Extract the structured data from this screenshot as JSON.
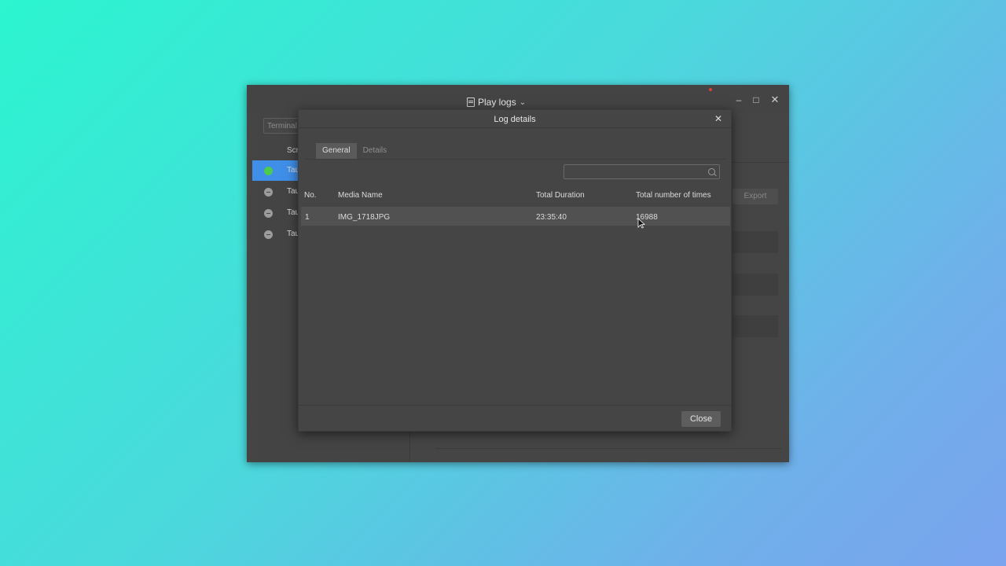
{
  "app": {
    "title": "Play logs",
    "controls": {
      "minimize": "–",
      "maximize": "□",
      "close": "✕"
    },
    "sidebar": {
      "search_placeholder": "Terminal N",
      "header": "Scr",
      "items": [
        {
          "label": "Tau",
          "status": "online"
        },
        {
          "label": "Tau",
          "status": "offline"
        },
        {
          "label": "Tau",
          "status": "offline"
        },
        {
          "label": "Tau",
          "status": "offline"
        }
      ]
    },
    "export_label": "Export"
  },
  "dialog": {
    "title": "Log details",
    "close_icon": "✕",
    "tabs": [
      {
        "label": "General",
        "active": true
      },
      {
        "label": "Details",
        "active": false
      }
    ],
    "search": {
      "placeholder": "",
      "value": ""
    },
    "table": {
      "columns": [
        "No.",
        "Media Name",
        "Total Duration",
        "Total number of times"
      ],
      "rows": [
        {
          "no": "1",
          "media_name": "IMG_1718JPG",
          "total_duration": "23:35:40",
          "total_times": "16988"
        }
      ]
    },
    "close_button": "Close"
  },
  "colors": {
    "accent": "#3f8ee8",
    "status_online": "#4ccb4f",
    "status_offline": "#9c9c9c",
    "background_start": "#2bf5cf",
    "background_end": "#7aa3ee"
  }
}
